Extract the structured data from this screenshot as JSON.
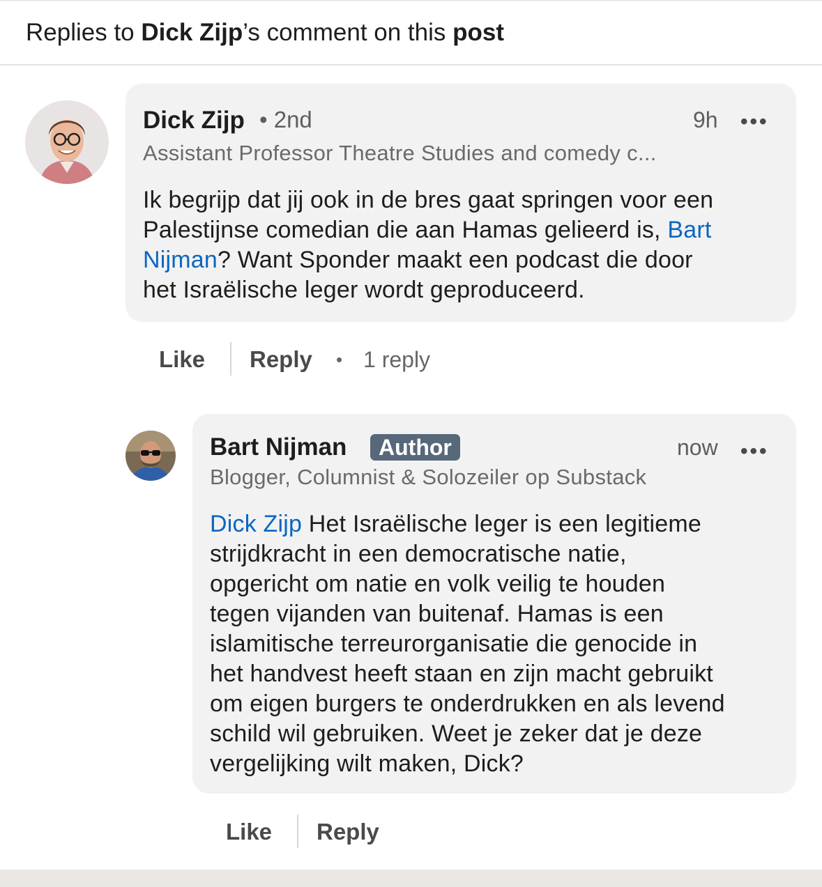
{
  "header": {
    "prefix": "Replies to ",
    "author": "Dick Zijp",
    "middle": "’s comment on this ",
    "post_word": "post"
  },
  "comment": {
    "author_name": "Dick Zijp",
    "degree": "• 2nd",
    "time": "9h",
    "more": "•••",
    "headline": "Assistant Professor Theatre Studies and comedy c...",
    "body_before": "Ik begrijp dat jij ook in de bres gaat springen voor een\nPalestijnse comedian die aan Hamas gelieerd is, ",
    "mention": "Bart\nNijman",
    "body_after": "? Want Sponder maakt een podcast die door\nhet Israëlische leger wordt geproduceerd.",
    "like_label": "Like",
    "reply_label": "Reply",
    "separator": "•",
    "reply_count": "1 reply"
  },
  "reply": {
    "author_name": "Bart Nijman",
    "badge": "Author",
    "time": "now",
    "more": "•••",
    "headline": "Blogger, Columnist & Solozeiler op Substack",
    "mention": "Dick Zijp",
    "body_after": " Het Israëlische leger is een legitieme\nstrijdkracht in een democratische natie,\nopgericht om natie en volk veilig te houden\ntegen vijanden van buitenaf. Hamas is een\nislamitische terreurorganisatie die genocide in\nhet handvest heeft staan en zijn macht gebruikt\nom eigen burgers te onderdrukken en als levend\nschild wil gebruiken. Weet je zeker dat je deze\nvergelijking wilt maken, Dick?",
    "like_label": "Like",
    "reply_label": "Reply"
  },
  "colors": {
    "mention": "#0a66c2",
    "badge_bg": "#56687a",
    "bubble_bg": "#f2f2f2"
  }
}
